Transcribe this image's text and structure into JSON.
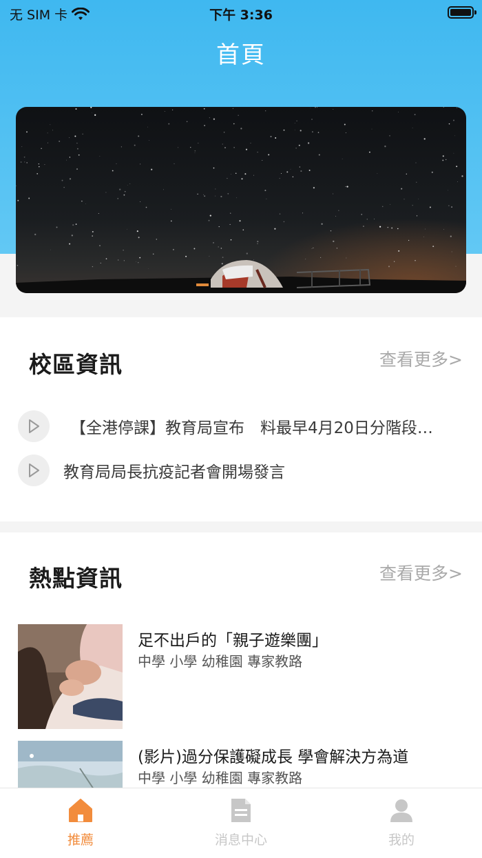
{
  "status_bar": {
    "carrier": "无 SIM 卡",
    "time": "下午 3:36"
  },
  "header": {
    "title": "首頁"
  },
  "school_news": {
    "title": "校區資訊",
    "more": "查看更多>",
    "items": [
      {
        "text": "【全港停課】教育局宣布　料最早4月20日分階段…"
      },
      {
        "text": "教育局局長抗疫記者會開場發言"
      }
    ]
  },
  "hot_news": {
    "title": "熱點資訊",
    "more": "查看更多>",
    "items": [
      {
        "title": "足不出戶的「親子遊樂團」",
        "tags": "中學 小學 幼稚園 專家教路"
      },
      {
        "title": "(影片)過分保護礙成長 學會解決方為道",
        "tags": "中學 小學 幼稚園 專家教路"
      }
    ]
  },
  "tabbar": {
    "tabs": [
      {
        "label": "推薦",
        "icon": "home-icon",
        "active": true
      },
      {
        "label": "消息中心",
        "icon": "document-icon",
        "active": false
      },
      {
        "label": "我的",
        "icon": "user-icon",
        "active": false
      }
    ]
  },
  "colors": {
    "header_blue": "#3fb8f0",
    "accent_orange": "#f28c3c",
    "inactive_gray": "#c7c7c7"
  }
}
